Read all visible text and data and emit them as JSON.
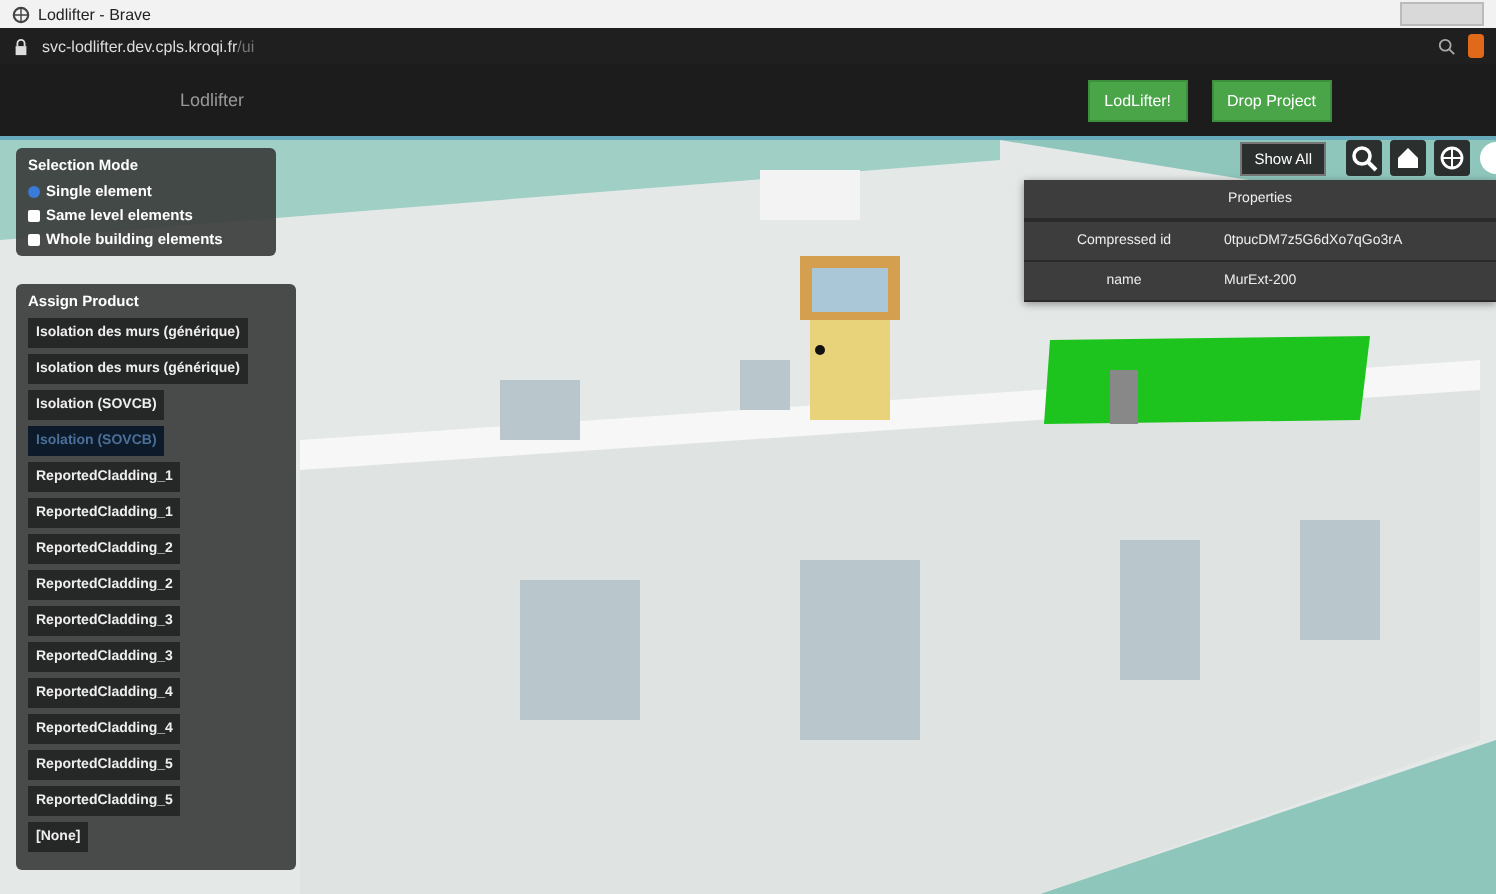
{
  "window": {
    "title": "Lodlifter - Brave"
  },
  "address_bar": {
    "url": "svc-lodlifter.dev.cpls.kroqi.fr",
    "url_path": "/ui"
  },
  "app_header": {
    "title": "Lodlifter",
    "buttons": [
      "LodLifter!",
      "Drop Project"
    ]
  },
  "selection_mode": {
    "title": "Selection Mode",
    "options": [
      {
        "label": "Single element",
        "selected": true
      },
      {
        "label": "Same level elements",
        "selected": false
      },
      {
        "label": "Whole building elements",
        "selected": false
      }
    ]
  },
  "assign_product": {
    "title": "Assign Product",
    "items": [
      {
        "label": "Isolation des murs (générique)",
        "selected": false
      },
      {
        "label": "Isolation des murs (générique)",
        "selected": false
      },
      {
        "label": "Isolation (SOVCB)",
        "selected": false
      },
      {
        "label": "Isolation (SOVCB)",
        "selected": true
      },
      {
        "label": "ReportedCladding_1",
        "selected": false
      },
      {
        "label": "ReportedCladding_1",
        "selected": false
      },
      {
        "label": "ReportedCladding_2",
        "selected": false
      },
      {
        "label": "ReportedCladding_2",
        "selected": false
      },
      {
        "label": "ReportedCladding_3",
        "selected": false
      },
      {
        "label": "ReportedCladding_3",
        "selected": false
      },
      {
        "label": "ReportedCladding_4",
        "selected": false
      },
      {
        "label": "ReportedCladding_4",
        "selected": false
      },
      {
        "label": "ReportedCladding_5",
        "selected": false
      },
      {
        "label": "ReportedCladding_5",
        "selected": false
      },
      {
        "label": "[None]",
        "selected": false
      }
    ]
  },
  "toolbar": {
    "show_all": "Show All"
  },
  "properties": {
    "title": "Properties",
    "rows": [
      {
        "key": "Compressed id",
        "value": "0tpucDM7z5G6dXo7qGo3rA"
      },
      {
        "key": "name",
        "value": "MurExt-200"
      }
    ]
  }
}
